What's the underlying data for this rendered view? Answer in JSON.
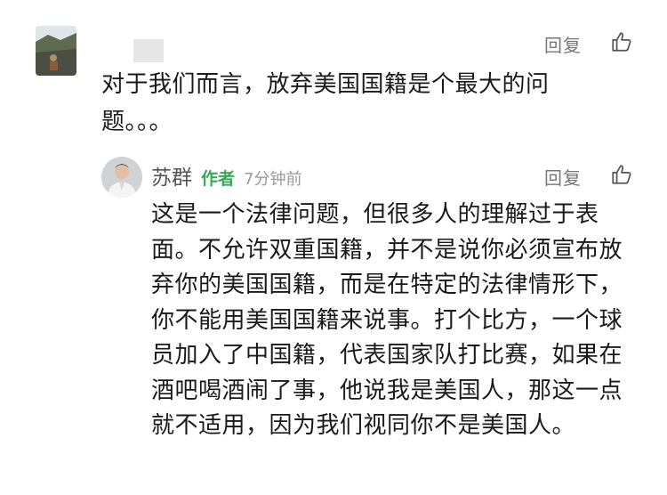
{
  "comment": {
    "text": "对于我们而言，放弃美国国籍是个最大的问题。。。",
    "reply_label": "回复",
    "like_icon": "thumbs-up-icon"
  },
  "reply": {
    "author_name": "苏群",
    "author_tag": "作者",
    "time": "7分钟前",
    "reply_label": "回复",
    "like_icon": "thumbs-up-icon",
    "text": "这是一个法律问题，但很多人的理解过于表面。不允许双重国籍，并不是说你必须宣布放弃你的美国国籍，而是在特定的法律情形下，你不能用美国国籍来说事。打个比方，一个球员加入了中国籍，代表国家队打比赛，如果在酒吧喝酒闹了事，他说我是美国人，那这一点就不适用，因为我们视同你不是美国人。"
  },
  "colors": {
    "author_tag": "#3aa856",
    "muted": "#777777",
    "text": "#1a1a1a"
  }
}
